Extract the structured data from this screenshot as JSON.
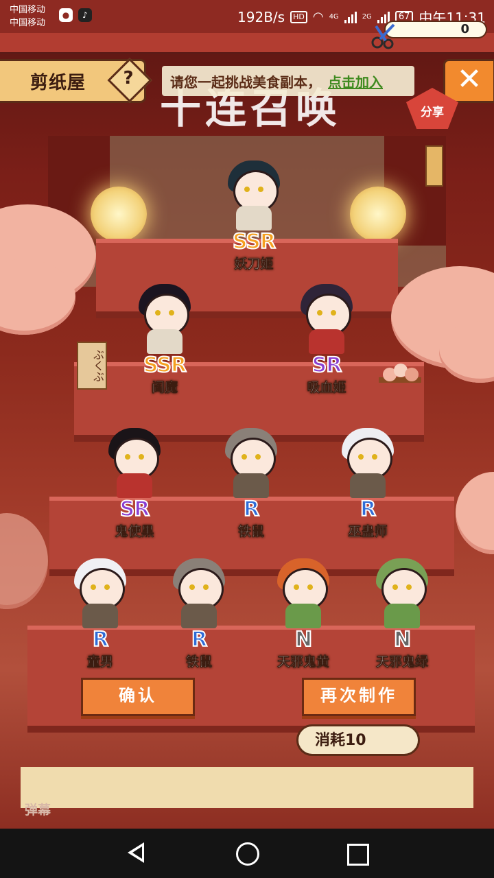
{
  "status_bar": {
    "carrier_1": "中国移动",
    "carrier_2": "中国移动",
    "net_speed": "192B/s",
    "hd": "HD",
    "net_4g": "4G",
    "net_2g": "2G",
    "battery": "67",
    "time": "中午11:31"
  },
  "header": {
    "title": "剪纸屋",
    "help": "?",
    "marquee_text": "请您一起挑战美食副本，",
    "marquee_link": "点击加入",
    "event_banner": "十连召唤",
    "close": "✕",
    "share": "分享",
    "counter_value": "0"
  },
  "decor": {
    "note_text": "ぶくぶ"
  },
  "characters": [
    {
      "name": "妖刀姬",
      "rarity": "SSR"
    },
    {
      "name": "阎魔",
      "rarity": "SSR"
    },
    {
      "name": "吸血姬",
      "rarity": "SR"
    },
    {
      "name": "鬼使黑",
      "rarity": "SR"
    },
    {
      "name": "铁鼠",
      "rarity": "R"
    },
    {
      "name": "巫蛊师",
      "rarity": "R"
    },
    {
      "name": "童男",
      "rarity": "R"
    },
    {
      "name": "铁鼠",
      "rarity": "R"
    },
    {
      "name": "天邪鬼黄",
      "rarity": "N"
    },
    {
      "name": "天邪鬼绿",
      "rarity": "N"
    }
  ],
  "actions": {
    "confirm": "确认",
    "redo": "再次制作",
    "cost": "消耗10"
  },
  "footer": {
    "danmaku": "弹幕"
  },
  "colors": {
    "accent": "#f0833a",
    "ssr": "#f5a020",
    "sr": "#8a3ed1",
    "r": "#2f6cd6",
    "n": "#666666"
  }
}
